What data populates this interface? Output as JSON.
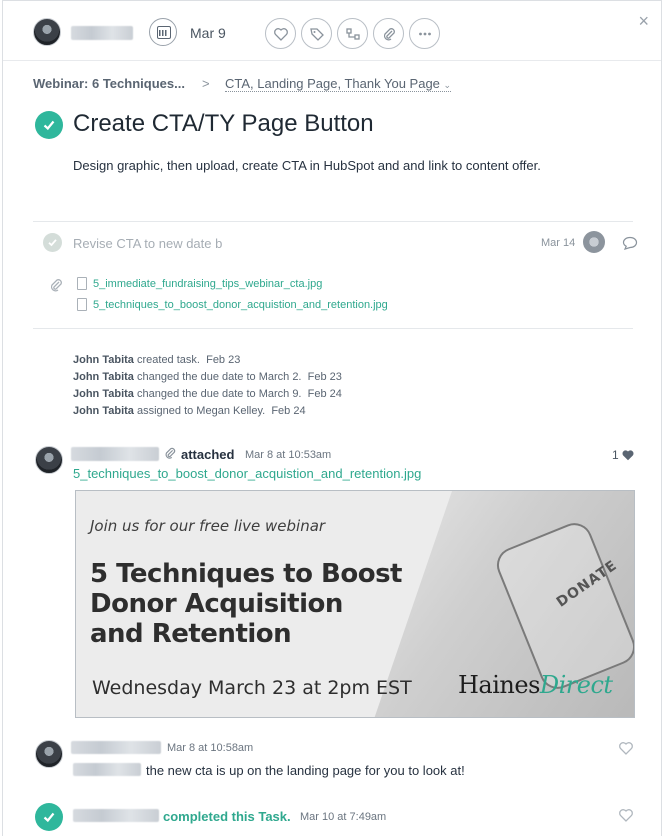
{
  "header": {
    "due_date": "Mar 9",
    "close_glyph": "×",
    "action_icons": [
      "heart-icon",
      "tag-icon",
      "subtask-icon",
      "attachment-icon",
      "more-icon"
    ]
  },
  "breadcrumb": {
    "project": "Webinar: 6 Techniques...",
    "separator": ">",
    "tags": "CTA, Landing Page, Thank You Page"
  },
  "task": {
    "title": "Create CTA/TY Page Button",
    "description": "Design graphic, then upload, create CTA in HubSpot and and link to content offer."
  },
  "subtask": {
    "text": "Revise CTA to new date b",
    "due": "Mar 14"
  },
  "attachments": [
    "5_immediate_fundraising_tips_webinar_cta.jpg",
    "5_techniques_to_boost_donor_acquistion_and_retention.jpg"
  ],
  "activity": [
    {
      "user": "John Tabita",
      "action": "created task.",
      "date": "Feb 23"
    },
    {
      "user": "John Tabita",
      "action": "changed the due date to March 2.",
      "date": "Feb 23"
    },
    {
      "user": "John Tabita",
      "action": "changed the due date to March 9.",
      "date": "Feb 24"
    },
    {
      "user": "John Tabita",
      "action": "assigned to Megan Kelley.",
      "date": "Feb 24"
    }
  ],
  "comment_attach": {
    "verb": "attached",
    "time": "Mar 8 at 10:53am",
    "likes": "1",
    "file": "5_techniques_to_boost_donor_acquistion_and_retention.jpg"
  },
  "banner": {
    "intro": "Join us for our free live webinar",
    "headline_1": "5 Techniques to Boost",
    "headline_2": "Donor Acquisition",
    "headline_3": "and Retention",
    "date_line": "Wednesday March 23 at 2pm EST",
    "logo_1": "Haines",
    "logo_2": "Direct",
    "jar_label": "DONATE"
  },
  "comment_text": {
    "time": "Mar 8 at 10:58am",
    "text": "the new cta is up on the landing page for you to look at!"
  },
  "completion": {
    "text": "completed this Task.",
    "time": "Mar 10 at 7:49am"
  },
  "colors": {
    "accent": "#2fb79c",
    "link": "#2fa88e",
    "text": "#273240"
  }
}
